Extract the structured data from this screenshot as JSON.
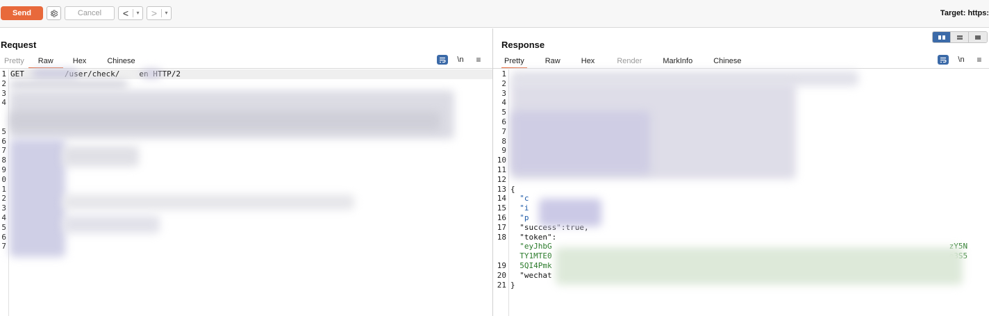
{
  "toolbar": {
    "send_label": "Send",
    "settings_icon": "gear-icon",
    "cancel_label": "Cancel",
    "back_arrow": "<",
    "forward_arrow": ">",
    "dropdown_caret": "▾",
    "target_label": "Target: https:"
  },
  "request": {
    "title": "Request",
    "tabs": [
      "Pretty",
      "Raw",
      "Hex",
      "Chinese"
    ],
    "active_tab": "Raw",
    "line_numbers": [
      "1",
      "2",
      "3",
      "4",
      "",
      "",
      "5",
      "6",
      "7",
      "8",
      "9",
      "0",
      "1",
      "2",
      "3",
      "4",
      "5",
      "6",
      "7"
    ],
    "first_line": {
      "method": "GET",
      "path_mid": "/user/check/",
      "path_end": "en HTTP/2"
    }
  },
  "response": {
    "title": "Response",
    "tabs": [
      "Pretty",
      "Raw",
      "Hex",
      "Render",
      "MarkInfo",
      "Chinese"
    ],
    "active_tab": "Pretty",
    "line_numbers": [
      "1",
      "2",
      "3",
      "4",
      "5",
      "6",
      "7",
      "8",
      "9",
      "10",
      "11",
      "12",
      "13",
      "14",
      "15",
      "16",
      "17",
      "18",
      "",
      "",
      "19",
      "20",
      "21"
    ],
    "json": {
      "open_brace": "{",
      "key_c": "\"c",
      "key_i": "\"i",
      "key_p": "\"p",
      "success_line": "\"success\":true,",
      "token_key": "\"token\":",
      "token_start": "\"eyJhbG",
      "token_end1": "zY5N",
      "token_line2": "TY1MTE0",
      "token_end2": "e3S5",
      "token_line3": "5QI4Pmk",
      "wechat_key": "\"wechat",
      "close_brace": "}"
    }
  },
  "editor_tools": {
    "wrap_icon": "wrap-lines-icon",
    "newline_label": "\\n",
    "menu_icon": "≡"
  },
  "colors": {
    "accent": "#e8693b",
    "toggle_active": "#3b6aa8"
  }
}
